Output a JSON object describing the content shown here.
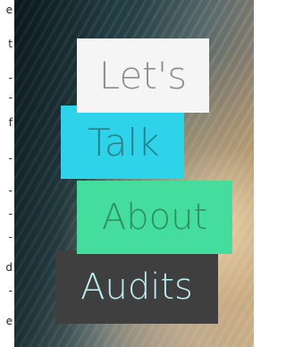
{
  "sidebar_text_fragments": [
    "e",
    "t",
    "-",
    "-",
    "f",
    "-",
    "-",
    "-",
    "-",
    "d",
    "-",
    "e"
  ],
  "hero": {
    "words": [
      "Let's",
      "Talk",
      "About",
      "Audits"
    ]
  }
}
